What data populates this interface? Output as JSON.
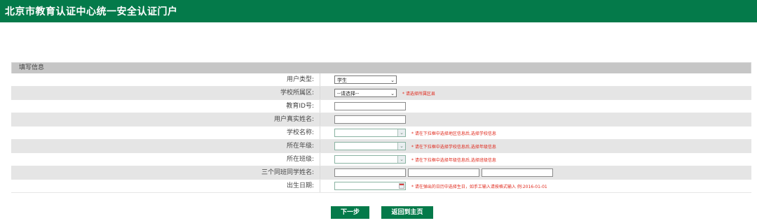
{
  "header": {
    "title": "北京市教育认证中心统一安全认证门户"
  },
  "section": {
    "title": "填写信息"
  },
  "form": {
    "user_type": {
      "label": "用户类型:",
      "value": "学生"
    },
    "district": {
      "label": "学校所属区:",
      "value": "--请选择--",
      "hint": "* 请选择所属区县"
    },
    "edu_id": {
      "label": "教育ID号:"
    },
    "real_name": {
      "label": "用户真实姓名:"
    },
    "school": {
      "label": "学校名称:",
      "hint": "* 请在下拉框中选择地区信息后,选择学校信息"
    },
    "grade": {
      "label": "所在年级:",
      "hint": "* 请在下拉框中选择学校信息后,选择年级信息"
    },
    "class": {
      "label": "所在班级:",
      "hint": "* 请在下拉框中选择年级信息后,选择班级信息"
    },
    "classmates": {
      "label": "三个同班同学姓名:"
    },
    "birthday": {
      "label": "出生日期:",
      "hint": "* 请在弹出的日历中选择生日，如手工输入请按格式输入 例:2016-01-01"
    }
  },
  "buttons": {
    "next": "下一步",
    "home": "返回到主页"
  }
}
